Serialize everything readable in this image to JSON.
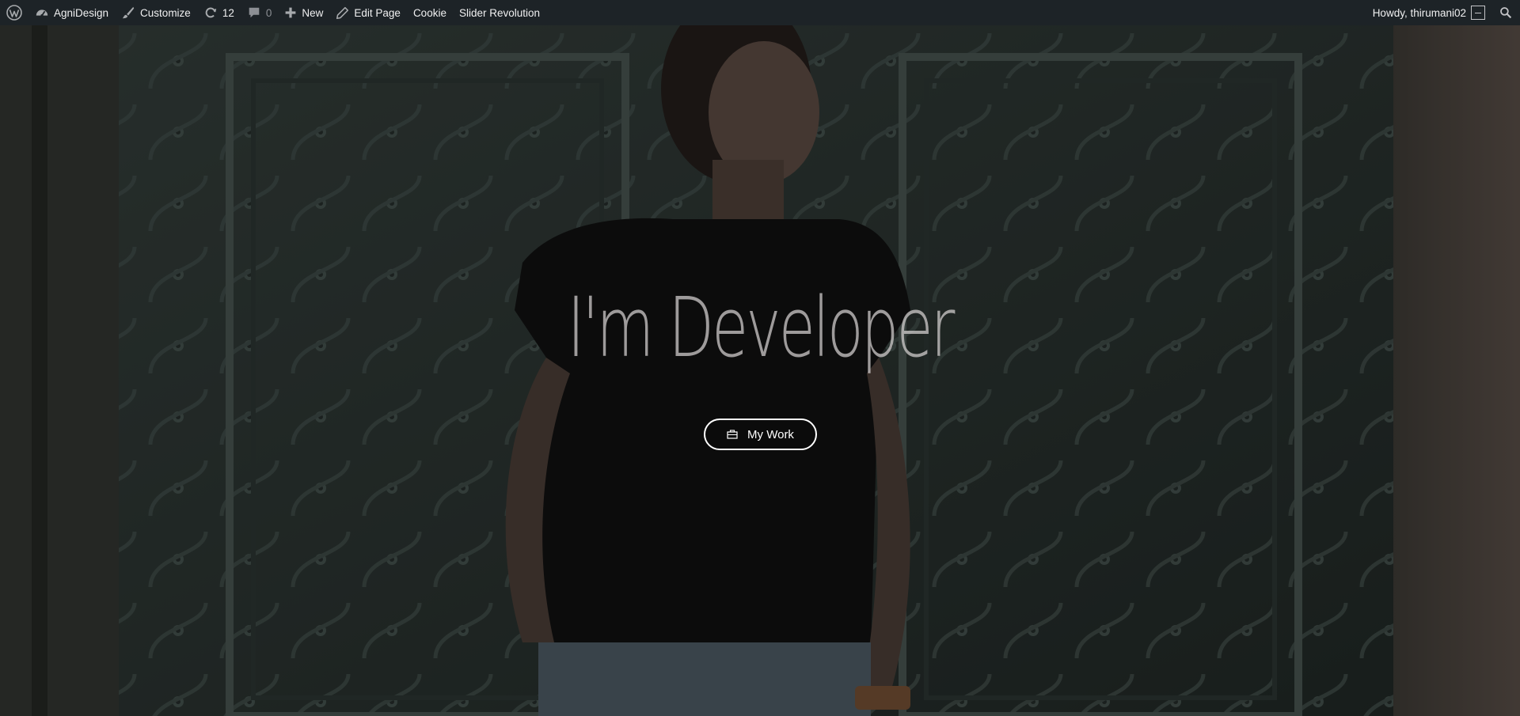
{
  "admin_bar": {
    "site_name": "AgniDesign",
    "customize": "Customize",
    "updates_count": "12",
    "comments_count": "0",
    "new_label": "New",
    "edit_page": "Edit Page",
    "cookie": "Cookie",
    "slider_revolution": "Slider Revolution",
    "howdy": "Howdy, thirumani02",
    "icons": {
      "wordpress": "wordpress-logo-icon",
      "site": "dashboard-icon",
      "customize": "brush-icon",
      "updates": "refresh-icon",
      "comments": "comment-bubble-icon",
      "new": "plus-icon",
      "edit": "pencil-icon",
      "search": "search-icon"
    },
    "colors": {
      "background": "#1d2327",
      "text": "#f0f0f1",
      "icon": "#a7aaad"
    }
  },
  "hero": {
    "headline": "I'm Developer",
    "button_label": "My Work",
    "button_icon": "briefcase-icon",
    "colors": {
      "overlay": "rgba(0,0,0,0.38)",
      "headline": "#d7d2d2",
      "button_border": "#ffffff"
    }
  }
}
